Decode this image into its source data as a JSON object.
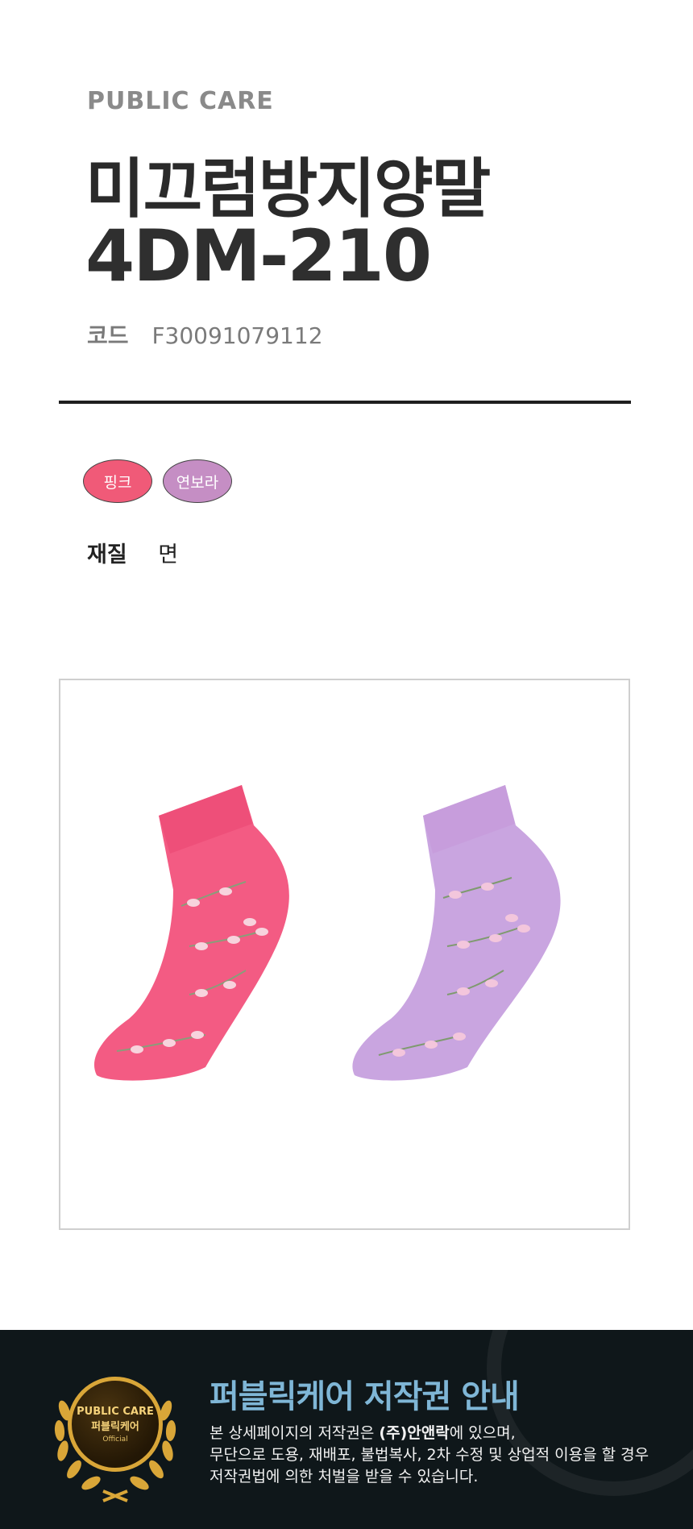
{
  "brand": "PUBLIC CARE",
  "product": {
    "name": "미끄럼방지양말",
    "model": "4DM-210",
    "code_label": "코드",
    "code_value": "F30091079112"
  },
  "colors": [
    {
      "label": "핑크",
      "hex": "#f05a78"
    },
    {
      "label": "연보라",
      "hex": "#c58ec4"
    }
  ],
  "material": {
    "label": "재질",
    "value": "면"
  },
  "footer": {
    "title": "퍼블릭케어 저작권 안내",
    "line1_pre": "본 상세페이지의 저작권은 ",
    "line1_strong": "(주)안앤락",
    "line1_post": "에 있으며,",
    "line2": "무단으로 도용, 재배포, 불법복사, 2차 수정 및 상업적 이용을 할 경우",
    "line3": "저작권법에 의한 처벌을 받을 수 있습니다.",
    "badge": {
      "line1": "PUBLIC CARE",
      "line2": "퍼블릭케어",
      "line3": "Official"
    }
  }
}
